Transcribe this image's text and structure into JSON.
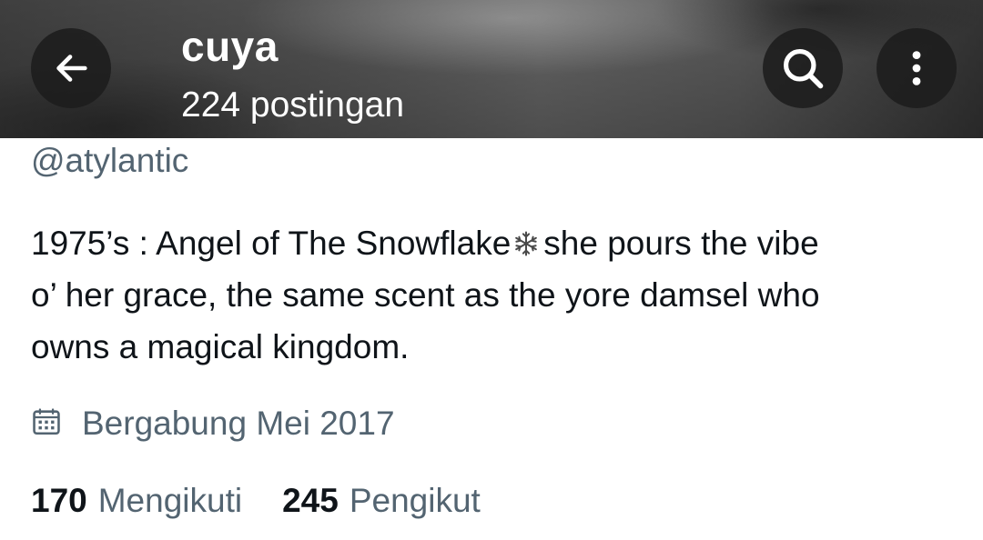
{
  "header": {
    "title": "cuya",
    "post_count": "224 postingan",
    "back_icon": "arrow-left-icon",
    "search_icon": "search-icon",
    "more_icon": "more-vertical-icon"
  },
  "profile": {
    "handle": "@atylantic",
    "bio_lines": [
      "1975’s : Angel of The Snowflake",
      "she pours the vibe",
      "o’ her grace, the same scent as the yore damsel who",
      "owns a magical kingdom."
    ],
    "bio_emoji": "snowflake-icon",
    "joined": "Bergabung Mei 2017",
    "joined_icon": "calendar-icon",
    "following_count": "170",
    "following_label": "Mengikuti",
    "followers_count": "245",
    "followers_label": "Pengikut"
  },
  "colors": {
    "primary_text": "#0f1419",
    "secondary_text": "#536471",
    "button_bg": "#1c1c1c"
  }
}
